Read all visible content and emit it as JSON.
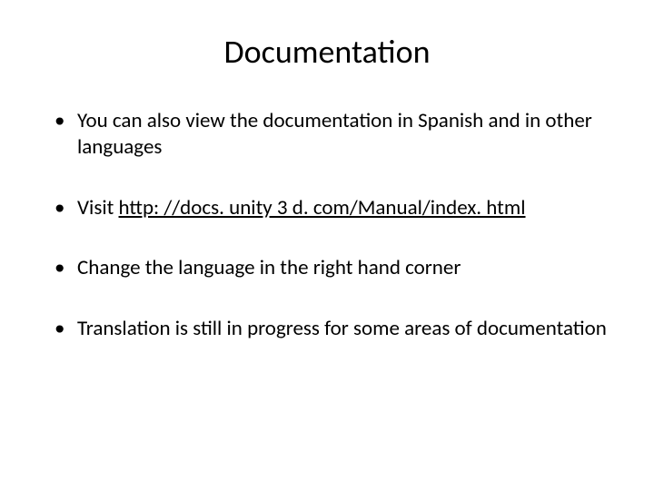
{
  "title": "Documentation",
  "bullets": [
    {
      "text": "You can also view the documentation in Spanish and in other languages"
    },
    {
      "prefix": "Visit ",
      "link": "http: //docs. unity 3 d. com/Manual/index. html"
    },
    {
      "text": "Change the language in the right hand corner"
    },
    {
      "text": "Translation is still in progress for some areas of documentation"
    }
  ]
}
